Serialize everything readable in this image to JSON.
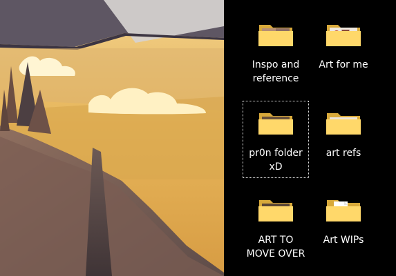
{
  "desktop": {
    "items": [
      {
        "label": "Inspo and reference",
        "icon": "folder-icon",
        "selected": false
      },
      {
        "label": "Art for me",
        "icon": "folder-icon",
        "selected": false
      },
      {
        "label": "pr0n folder xD",
        "icon": "folder-icon",
        "selected": true
      },
      {
        "label": "art refs",
        "icon": "folder-icon",
        "selected": false
      },
      {
        "label": "ART TO MOVE OVER",
        "icon": "folder-icon",
        "selected": false
      },
      {
        "label": "Art WIPs",
        "icon": "folder-icon",
        "selected": false
      }
    ]
  },
  "colors": {
    "desktop_background": "#000000",
    "folder_back": "#d8a93a",
    "folder_front": "#ffd86a",
    "label_text": "#ffffff",
    "selection_border": "#dcdcdc"
  }
}
